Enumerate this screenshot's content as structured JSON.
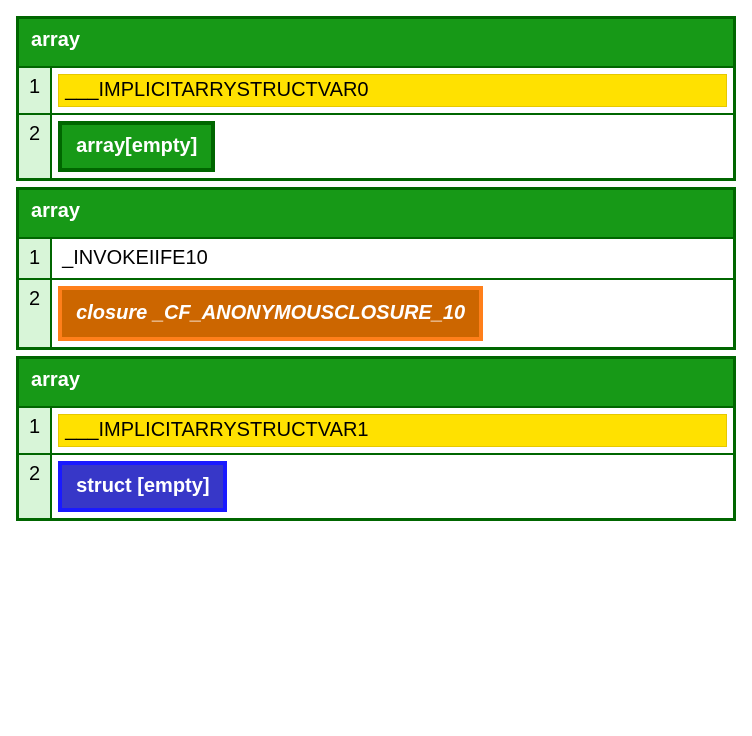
{
  "blocks": [
    {
      "header": "array",
      "rows": [
        {
          "index": "1",
          "type": "yellow",
          "value": "___IMPLICITARRYSTRUCTVAR0"
        },
        {
          "index": "2",
          "type": "green",
          "value": "array[empty]"
        }
      ]
    },
    {
      "header": "array",
      "rows": [
        {
          "index": "1",
          "type": "plain",
          "value": "_INVOKEIIFE10"
        },
        {
          "index": "2",
          "type": "orange",
          "value": "closure _CF_ANONYMOUSCLOSURE_10"
        }
      ]
    },
    {
      "header": "array",
      "rows": [
        {
          "index": "1",
          "type": "yellow",
          "value": "___IMPLICITARRYSTRUCTVAR1"
        },
        {
          "index": "2",
          "type": "blue",
          "value": "struct [empty]"
        }
      ]
    }
  ]
}
